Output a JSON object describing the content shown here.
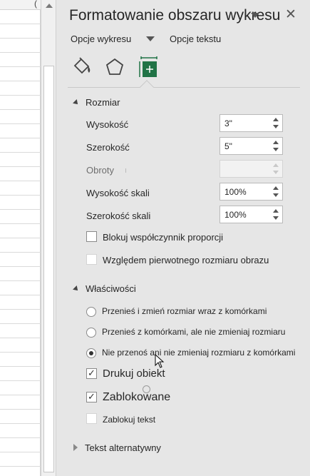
{
  "panel": {
    "title": "Formatowanie obszaru wykresu",
    "tabs": {
      "chart_options": "Opcje wykresu",
      "text_options": "Opcje tekstu"
    },
    "icons": [
      "fill-line-icon",
      "effects-icon",
      "size-properties-icon"
    ]
  },
  "size_section": {
    "header": "Rozmiar",
    "height": {
      "label": "Wysokość",
      "value": "3\""
    },
    "width": {
      "label": "Szerokość",
      "value": "5\""
    },
    "rotation": {
      "label": "Obroty",
      "value": ""
    },
    "scale_height": {
      "label": "Wysokość skali",
      "value": "100%"
    },
    "scale_width": {
      "label": "Szerokość skali",
      "value": "100%"
    },
    "lock_aspect": {
      "label": "Blokuj współczynnik proporcji",
      "checked": false
    },
    "relative_original": {
      "label": "Względem pierwotnego rozmiaru obrazu",
      "checked": false
    }
  },
  "properties_section": {
    "header": "Właściwości",
    "radio_move_size": "Przenieś i zmień rozmiar wraz z komórkami",
    "radio_move_only": "Przenieś z komórkami, ale nie zmieniaj rozmiaru",
    "radio_no_move": "Nie przenoś ani nie zmieniaj rozmiaru z komórkami",
    "selected_radio": "radio_no_move",
    "print_object": {
      "label": "Drukuj obiekt",
      "checked": true
    },
    "locked": {
      "label": "Zablokowane",
      "checked": true
    },
    "lock_text": {
      "label": "Zablokuj tekst",
      "checked": false
    }
  },
  "alt_text_section": {
    "header": "Tekst alternatywny"
  },
  "sheet": {
    "col_glyph": "("
  },
  "colors": {
    "panel_bg": "#e6e6e6",
    "accent_green": "#217346"
  }
}
